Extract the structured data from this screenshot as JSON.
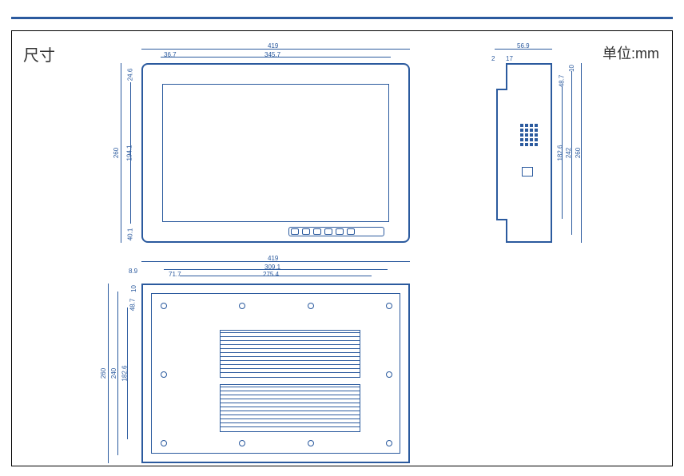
{
  "labels": {
    "title": "尺寸",
    "unit": "单位:mm"
  },
  "front_view": {
    "overall_width": "419",
    "bezel_left": "36.7",
    "screen_width": "345.7",
    "overall_height": "260",
    "screen_height": "194.1",
    "bezel_top": "24.6",
    "bezel_bottom": "40.1"
  },
  "side_view": {
    "overall_depth": "56.9",
    "panel_thickness": "2",
    "inset": "17",
    "top_margin": "10",
    "bracket_offset": "48.7",
    "height": "260",
    "inner_height": "242",
    "mid_height": "182.6"
  },
  "back_view": {
    "overall_width": "419",
    "inner_width": "309.1",
    "heatsink_width": "275.4",
    "edge": "8.9",
    "mount_offset": "71.7",
    "overall_height": "260",
    "inner_height": "240",
    "heatsink_height": "182.6",
    "top_margin": "10",
    "upper_offset": "48.7"
  }
}
